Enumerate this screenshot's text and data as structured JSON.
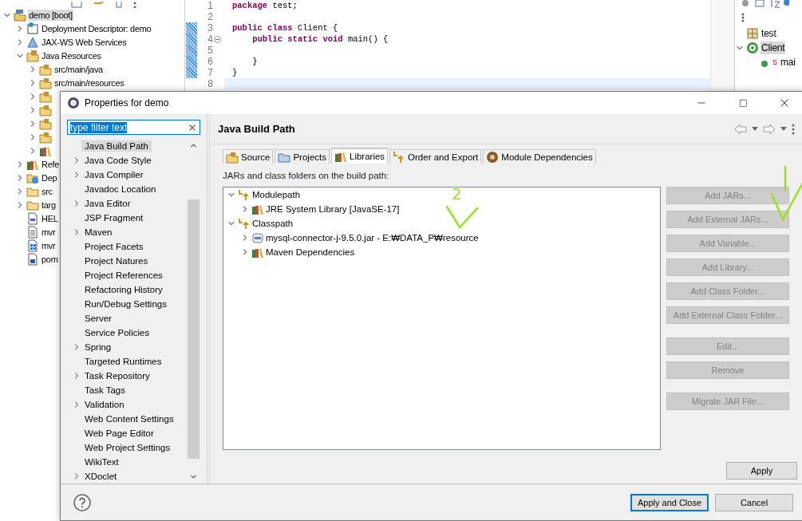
{
  "explorer": {
    "items": [
      {
        "label": "demo [boot]",
        "kind": "project",
        "expandable": true,
        "expanded": true,
        "selected": true,
        "children": [
          {
            "label": "Deployment Descriptor: demo",
            "kind": "descriptor",
            "expandable": true,
            "expanded": false,
            "selected": false
          },
          {
            "label": "JAX-WS Web Services",
            "kind": "webservice",
            "expandable": true,
            "expanded": false,
            "selected": false
          },
          {
            "label": "Java Resources",
            "kind": "resources",
            "expandable": true,
            "expanded": true,
            "selected": false,
            "children": [
              {
                "label": "src/main/java",
                "kind": "srcfolder",
                "expandable": true,
                "expanded": false,
                "selected": false
              },
              {
                "label": "src/main/resources",
                "kind": "srcfolder",
                "expandable": true,
                "expanded": false,
                "selected": false
              },
              {
                "kind": "srcfolder",
                "expandable": true,
                "expanded": false
              },
              {
                "kind": "srcfolder",
                "expandable": true,
                "expanded": false
              },
              {
                "kind": "srcfolder",
                "expandable": true,
                "expanded": false
              },
              {
                "kind": "srcfolder",
                "expandable": true,
                "expanded": false
              },
              {
                "kind": "library",
                "expandable": true,
                "expanded": false
              }
            ]
          },
          {
            "label": "Refe",
            "kind": "library",
            "expandable": true,
            "expanded": false,
            "selected": false
          },
          {
            "label": "Dep",
            "kind": "deployed",
            "expandable": true,
            "expanded": false,
            "selected": false
          },
          {
            "label": "src",
            "kind": "folder",
            "expandable": true,
            "expanded": false,
            "selected": false
          },
          {
            "label": "targ",
            "kind": "folder",
            "expandable": true,
            "expanded": false,
            "selected": false
          },
          {
            "label": "HEL",
            "kind": "doc",
            "expandable": false,
            "selected": false
          },
          {
            "label": "mvr",
            "kind": "text",
            "expandable": false,
            "selected": false
          },
          {
            "label": "mvr",
            "kind": "script",
            "expandable": false,
            "selected": false
          },
          {
            "label": "pom",
            "kind": "maven",
            "expandable": false,
            "selected": false
          }
        ]
      }
    ]
  },
  "editor": {
    "lines": [
      {
        "number": "1",
        "segments": [
          {
            "text": "package",
            "kind": "keyword"
          },
          {
            "text": " test;",
            "kind": "plain"
          }
        ],
        "changed": false,
        "current": false,
        "foldable": false
      },
      {
        "number": "2",
        "changed": false,
        "current": false,
        "foldable": false
      },
      {
        "number": "3",
        "segments": [
          {
            "text": "public class",
            "kind": "keyword"
          },
          {
            "text": " Client {",
            "kind": "plain"
          }
        ],
        "changed": true,
        "current": false,
        "foldable": false
      },
      {
        "number": "4",
        "segments": [
          {
            "text": "    public static void",
            "kind": "keyword"
          },
          {
            "text": " main() {",
            "kind": "plain"
          }
        ],
        "changed": true,
        "current": false,
        "foldable": true
      },
      {
        "number": "5",
        "changed": true,
        "current": false,
        "foldable": false
      },
      {
        "number": "6",
        "segments": [
          {
            "text": "    }",
            "kind": "plain"
          }
        ],
        "changed": true,
        "current": false,
        "foldable": false
      },
      {
        "number": "7",
        "segments": [
          {
            "text": "}",
            "kind": "plain"
          }
        ],
        "changed": true,
        "current": false,
        "foldable": false
      },
      {
        "number": "8",
        "changed": false,
        "current": true,
        "foldable": false
      }
    ]
  },
  "outline": {
    "items": [
      {
        "label": "test",
        "kind": "package",
        "expandable": false,
        "selected": false
      },
      {
        "label": "Client",
        "kind": "class",
        "expandable": true,
        "expanded": true,
        "selected": true,
        "children": [
          {
            "label": "mai",
            "kind": "method",
            "badge": "S",
            "expandable": false,
            "selected": false
          }
        ]
      }
    ]
  },
  "dialog": {
    "title": "Properties for demo",
    "filter": {
      "value": "type filter text",
      "selected": true
    },
    "nav": [
      {
        "label": "Java Build Path",
        "expandable": false,
        "selected": true
      },
      {
        "label": "Java Code Style",
        "expandable": true,
        "selected": false
      },
      {
        "label": "Java Compiler",
        "expandable": true,
        "selected": false
      },
      {
        "label": "Javadoc Location",
        "expandable": false,
        "selected": false
      },
      {
        "label": "Java Editor",
        "expandable": true,
        "selected": false
      },
      {
        "label": "JSP Fragment",
        "expandable": false,
        "selected": false
      },
      {
        "label": "Maven",
        "expandable": true,
        "selected": false
      },
      {
        "label": "Project Facets",
        "expandable": false,
        "selected": false
      },
      {
        "label": "Project Natures",
        "expandable": false,
        "selected": false
      },
      {
        "label": "Project References",
        "expandable": false,
        "selected": false
      },
      {
        "label": "Refactoring History",
        "expandable": false,
        "selected": false
      },
      {
        "label": "Run/Debug Settings",
        "expandable": false,
        "selected": false
      },
      {
        "label": "Server",
        "expandable": false,
        "selected": false
      },
      {
        "label": "Service Policies",
        "expandable": false,
        "selected": false
      },
      {
        "label": "Spring",
        "expandable": true,
        "selected": false
      },
      {
        "label": "Targeted Runtimes",
        "expandable": false,
        "selected": false
      },
      {
        "label": "Task Repository",
        "expandable": true,
        "selected": false
      },
      {
        "label": "Task Tags",
        "expandable": false,
        "selected": false
      },
      {
        "label": "Validation",
        "expandable": true,
        "selected": false
      },
      {
        "label": "Web Content Settings",
        "expandable": false,
        "selected": false
      },
      {
        "label": "Web Page Editor",
        "expandable": false,
        "selected": false
      },
      {
        "label": "Web Project Settings",
        "expandable": false,
        "selected": false
      },
      {
        "label": "WikiText",
        "expandable": false,
        "selected": false
      },
      {
        "label": "XDoclet",
        "expandable": true,
        "selected": false
      }
    ],
    "page": {
      "title": "Java Build Path",
      "tabs": [
        {
          "label": "Source",
          "kind": "source",
          "selected": false
        },
        {
          "label": "Projects",
          "kind": "projects",
          "selected": false
        },
        {
          "label": "Libraries",
          "kind": "libraries",
          "selected": true
        },
        {
          "label": "Order and Export",
          "kind": "order",
          "selected": false
        },
        {
          "label": "Module Dependencies",
          "kind": "module",
          "selected": false
        }
      ],
      "caption": "JARs and class folders on the build path:",
      "tree": [
        {
          "label": "Modulepath",
          "kind": "container",
          "expanded": true,
          "children": [
            {
              "label": "JRE System Library [JavaSE-17]",
              "kind": "library",
              "expanded": false
            }
          ]
        },
        {
          "label": "Classpath",
          "kind": "container",
          "expanded": true,
          "children": [
            {
              "label": "mysql-connector-j-9.5.0.jar - E:₩DATA_P₩resource",
              "kind": "jar",
              "expanded": false
            },
            {
              "label": "Maven Dependencies",
              "kind": "library",
              "expanded": false
            }
          ]
        }
      ],
      "button_groups": [
        [
          {
            "label": "Add JARs...",
            "disabled": true
          },
          {
            "label": "Add External JARs...",
            "disabled": true
          },
          {
            "label": "Add Variable...",
            "disabled": true
          },
          {
            "label": "Add Library...",
            "disabled": true
          },
          {
            "label": "Add Class Folder...",
            "disabled": true
          },
          {
            "label": "Add External Class Folder...",
            "disabled": true
          }
        ],
        [
          {
            "label": "Edit...",
            "disabled": true
          },
          {
            "label": "Remove",
            "disabled": true
          }
        ],
        [
          {
            "label": "Migrate JAR File...",
            "disabled": true
          }
        ]
      ],
      "apply": "Apply"
    },
    "footer": {
      "buttons": [
        {
          "label": "Apply and Close",
          "default": true
        },
        {
          "label": "Cancel",
          "default": false
        }
      ]
    },
    "annotations": [
      {
        "kind": "numbered-arrow",
        "text": "2"
      },
      {
        "kind": "arrow-check"
      }
    ]
  }
}
